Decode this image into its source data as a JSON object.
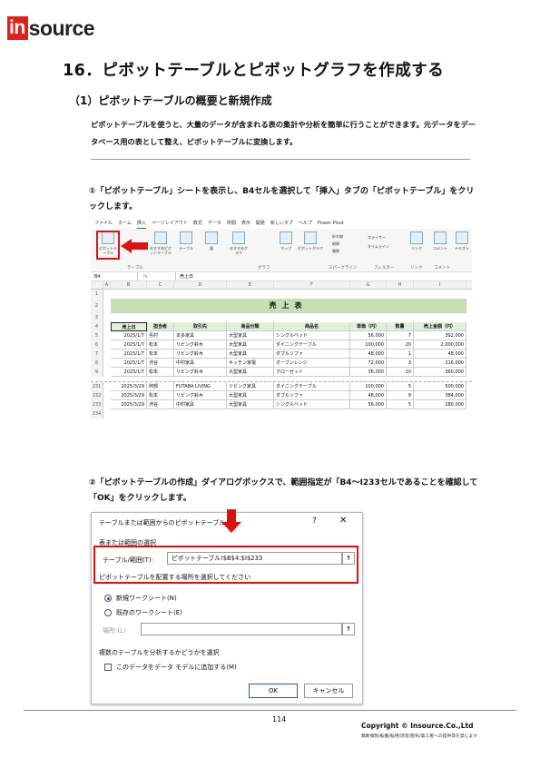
{
  "brand": {
    "logo_in": "in",
    "logo_rest": "source",
    "accent": "#e0201a"
  },
  "page": {
    "heading": "16．ピボットテーブルとピボットグラフを作成する",
    "subheading": "（1）ピボットテーブルの概要と新規作成",
    "intro": "ピボットテーブルを使うと、大量のデータが含まれる表の集計や分析を簡単に行うことができます。元データをデータベース用の表として整え、ピボットテーブルに変換します。",
    "step1": "①「ピボットテーブル」シートを表示し、B4セルを選択して「挿入」タブの「ピボットテーブル」をクリックします。",
    "step2": "②「ピボットテーブルの作成」ダイアログボックスで、範囲指定が「B4～I233セルであることを確認して「OK」をクリックします。"
  },
  "excel": {
    "menu": [
      "ファイル",
      "ホーム",
      "挿入",
      "ページレイアウト",
      "数式",
      "データ",
      "校閲",
      "表示",
      "開発",
      "新しいタブ",
      "ヘルプ",
      "Power Pivot"
    ],
    "ribbon": {
      "pivot": "ピボットテーブル",
      "recommended": "おすすめピボットテーブル",
      "table": "テーブル",
      "illust": "図",
      "rec_chart": "おすすめグラフ",
      "map": "マップ",
      "pivot_chart": "ピボットグラフ",
      "line": "折れ線",
      "column": "縦棒",
      "winloss": "勝敗",
      "slicer": "スライサー",
      "timeline": "タイムライン",
      "link": "リンク",
      "comment": "コメント",
      "text": "テキスト",
      "grp_table": "テーブル",
      "grp_chart": "グラフ",
      "grp_spark": "スパークライン",
      "grp_filter": "フィルター",
      "grp_link": "リンク",
      "grp_comment": "コメント"
    },
    "namebox": "B4",
    "fx": "fx",
    "formula": "売上日",
    "columns": [
      "A",
      "B",
      "C",
      "D",
      "E",
      "F",
      "G",
      "H",
      "I"
    ],
    "sheet_title": "売上表",
    "headers": [
      "売上日",
      "担当者",
      "取引先",
      "商品分類",
      "商品名",
      "単価（円）",
      "数量",
      "売上金額（円）"
    ],
    "rows_top": [
      {
        "n": "5",
        "c": [
          "2025/1/7",
          "島村",
          "本多家具",
          "大型家具",
          "シングルベッド",
          "56,000",
          "7",
          "392,000"
        ]
      },
      {
        "n": "6",
        "c": [
          "2025/1/7",
          "松本",
          "リビング鈴木",
          "大型家具",
          "ダイニングテーブル",
          "100,000",
          "20",
          "2,000,000"
        ]
      },
      {
        "n": "7",
        "c": [
          "2025/1/7",
          "松本",
          "リビング鈴木",
          "大型家具",
          "ダブルソファ",
          "48,000",
          "1",
          "48,000"
        ]
      },
      {
        "n": "8",
        "c": [
          "2025/1/7",
          "渋谷",
          "中村家具",
          "キッチン家電",
          "オーブンレンジ",
          "72,000",
          "3",
          "216,000"
        ]
      },
      {
        "n": "9",
        "c": [
          "2025/1/7",
          "松本",
          "リビング鈴木",
          "大型家具",
          "クローゼット",
          "36,000",
          "10",
          "360,000"
        ]
      }
    ],
    "rows_bottom": [
      {
        "n": "231",
        "c": [
          "2025/3/29",
          "阿部",
          "FUTABA LIVING",
          "リビング家具",
          "ダイニングテーブル",
          "100,000",
          "5",
          "500,000"
        ]
      },
      {
        "n": "232",
        "c": [
          "2025/3/29",
          "松本",
          "リビング鈴木",
          "大型家具",
          "ダブルソファ",
          "48,000",
          "8",
          "384,000"
        ]
      },
      {
        "n": "233",
        "c": [
          "2025/3/29",
          "渋谷",
          "中村家具",
          "大型家具",
          "シングルベッド",
          "56,000",
          "5",
          "280,000"
        ]
      }
    ],
    "row_labels_top": [
      "1",
      "2",
      "3",
      "4"
    ],
    "last_row": "234"
  },
  "dialog": {
    "title": "テーブルまたは範囲からのピボットテーブル",
    "help": "?",
    "close": "✕",
    "section1": "表または範囲の選択",
    "range_label": "テーブル/範囲(T):",
    "range_value": "ピボットテーブル!$B$4:$I$233",
    "section2": "ピボットテーブルを配置する場所を選択してください",
    "opt_new": "新規ワークシート(N)",
    "opt_existing": "既存のワークシート(E)",
    "location_label": "場所:(L)",
    "section3": "複数のテーブルを分析するかどうかを選択",
    "add_model": "このデータをデータ モデルに追加する(M)",
    "ok": "OK",
    "cancel": "キャンセル",
    "picker": "↑"
  },
  "footer": {
    "page_number": "114",
    "copyright": "Copyright © Insource.Co.,Ltd",
    "note": "無断複製/転載/転用/改変/配布/第三者への提供等を禁じます"
  }
}
